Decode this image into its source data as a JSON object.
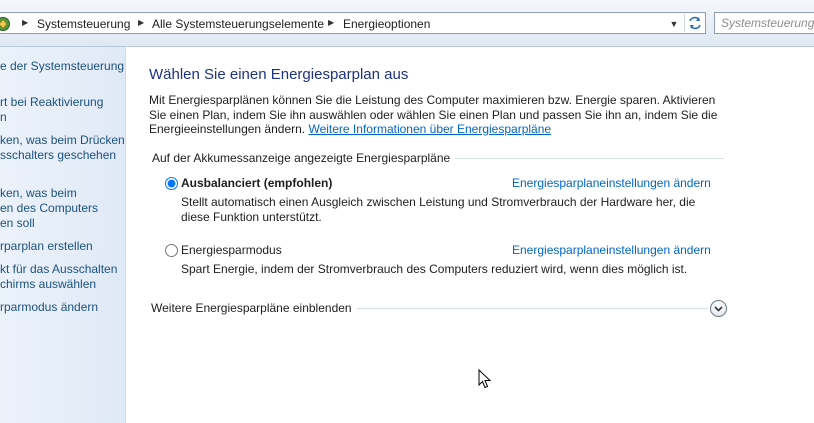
{
  "address_bar": {
    "breadcrumbs": [
      "Systemsteuerung",
      "Alle Systemsteuerungselemente",
      "Energieoptionen"
    ],
    "search_placeholder": "Systemsteuerung"
  },
  "sidebar": {
    "links": [
      "e der Systemsteuerung",
      "rt bei Reaktivierung\nn",
      "ken, was beim Drücken\nsschalters geschehen",
      "ken, was beim\nen des Computers\nen soll",
      "rparplan erstellen",
      "kt für das Ausschalten\nchirms auswählen",
      "rparmodus ändern"
    ]
  },
  "main": {
    "title": "Wählen Sie einen Energiesparplan aus",
    "intro_text": "Mit Energiesparplänen können Sie die Leistung des Computer maximieren bzw. Energie sparen. Aktivieren Sie einen Plan, indem Sie ihn auswählen oder wählen Sie einen Plan und passen Sie ihn an, indem Sie die Energieeinstellungen ändern.",
    "intro_link": "Weitere Informationen über Energiesparpläne",
    "group_header": "Auf der Akkumessanzeige angezeigte Energiesparpläne",
    "plans": [
      {
        "name": "Ausbalanciert (empfohlen)",
        "selected": true,
        "settings_link": "Energiesparplaneinstellungen ändern",
        "description": "Stellt automatisch einen Ausgleich zwischen Leistung und Stromverbrauch der Hardware her, die diese Funktion unterstützt."
      },
      {
        "name": "Energiesparmodus",
        "selected": false,
        "settings_link": "Energiesparplaneinstellungen ändern",
        "description": "Spart Energie, indem der Stromverbrauch des Computers reduziert wird, wenn dies möglich ist."
      }
    ],
    "more_plans_label": "Weitere Energiesparpläne einblenden"
  },
  "icons": {
    "address_icon": "control-panel-icon",
    "expand": "chevron-down-icon",
    "refresh": "refresh-icon",
    "cursor": "mouse-pointer-icon"
  },
  "colors": {
    "title": "#1e3287",
    "link": "#0066cc",
    "nav_link": "#1c5180",
    "sidebar_bg": "#e4edf8"
  }
}
